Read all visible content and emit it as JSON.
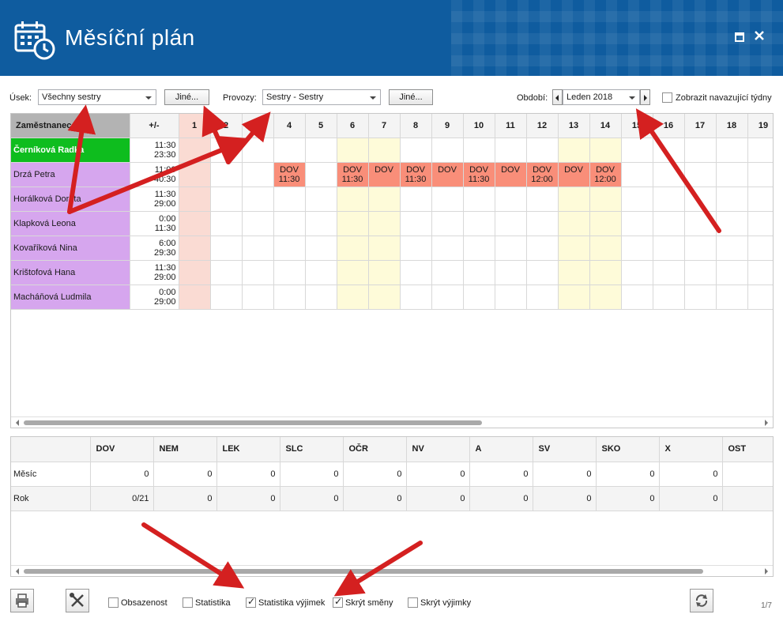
{
  "header": {
    "title": "Měsíční plán",
    "calendar_icon": "calendar-clock-icon",
    "restore_icon": "window-restore-icon",
    "close_icon": "close-icon",
    "color": "#0f5c9f"
  },
  "toolbar": {
    "usek_label": "Úsek:",
    "usek_value": "Všechny sestry",
    "other_button_1": "Jiné...",
    "provozy_label": "Provozy:",
    "provozy_value": "Sestry - Sestry",
    "other_button_2": "Jiné...",
    "obdobi_label": "Období:",
    "obdobi_value": "Leden 2018",
    "next_weeks_label": "Zobrazit navazující týdny",
    "next_weeks_checked": false
  },
  "plan": {
    "employee_header": "Zaměstnanec",
    "plusminus_header": "+/-",
    "days": [
      "1",
      "2",
      "3",
      "4",
      "5",
      "6",
      "7",
      "8",
      "9",
      "10",
      "11",
      "12",
      "13",
      "14",
      "15",
      "16",
      "17",
      "18",
      "19"
    ],
    "holiday_days": [
      "1"
    ],
    "weekend_days": [
      "6",
      "7",
      "13",
      "14"
    ],
    "employees": [
      {
        "name": "Černíková Radka",
        "hours": "11:30",
        "total": "23:30",
        "cells": {}
      },
      {
        "name": "Drzá Petra",
        "hours": "11:00",
        "total": "40:30",
        "cells": {
          "4": [
            "DOV",
            "11:30"
          ],
          "6": [
            "DOV",
            "11:30"
          ],
          "7": [
            "DOV",
            ""
          ],
          "8": [
            "DOV",
            "11:30"
          ],
          "9": [
            "DOV",
            ""
          ],
          "10": [
            "DOV",
            "11:30"
          ],
          "11": [
            "DOV",
            ""
          ],
          "12": [
            "DOV",
            "12:00"
          ],
          "13": [
            "DOV",
            ""
          ],
          "14": [
            "DOV",
            "12:00"
          ]
        }
      },
      {
        "name": "Horálková Dorota",
        "hours": "11:30",
        "total": "29:00",
        "cells": {}
      },
      {
        "name": "Klapková Leona",
        "hours": "0:00",
        "total": "11:30",
        "cells": {}
      },
      {
        "name": "Kovaříková Nina",
        "hours": "6:00",
        "total": "29:30",
        "cells": {}
      },
      {
        "name": "Krištofová Hana",
        "hours": "11:30",
        "total": "29:00",
        "cells": {}
      },
      {
        "name": "Macháňová Ludmila",
        "hours": "0:00",
        "total": "29:00",
        "cells": {}
      }
    ],
    "colors": {
      "first_row": "#0ebd1e",
      "name_bg": "#d6a6ee",
      "holiday": "#fadbd3",
      "weekend": "#fefbd9",
      "dov": "#f98e79"
    }
  },
  "stats": {
    "headers": [
      "DOV",
      "NEM",
      "LEK",
      "SLC",
      "OČR",
      "NV",
      "A",
      "SV",
      "SKO",
      "X",
      "OST"
    ],
    "rows": [
      {
        "label": "Měsíc",
        "values": [
          "0",
          "0",
          "0",
          "0",
          "0",
          "0",
          "0",
          "0",
          "0",
          "0",
          ""
        ]
      },
      {
        "label": "Rok",
        "values": [
          "0/21",
          "0",
          "0",
          "0",
          "0",
          "0",
          "0",
          "0",
          "0",
          "0",
          ""
        ]
      }
    ]
  },
  "bottom": {
    "print_icon": "print-icon",
    "tools_icon": "tools-icon",
    "refresh_icon": "refresh-icon",
    "checkboxes": [
      {
        "label": "Obsazenost",
        "checked": false
      },
      {
        "label": "Statistika",
        "checked": false
      },
      {
        "label": "Statistika výjimek",
        "checked": true
      },
      {
        "label": "Skrýt směny",
        "checked": true
      },
      {
        "label": "Skrýt výjimky",
        "checked": false
      }
    ],
    "page_indicator": "1/7"
  }
}
